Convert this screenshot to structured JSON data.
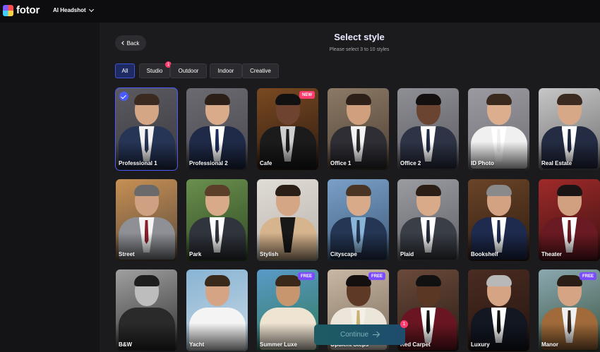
{
  "header": {
    "logo_text": "fotor",
    "product_menu_label": "AI Headshot"
  },
  "page": {
    "back_label": "Back",
    "title": "Select style",
    "subtitle": "Please select 3 to 10 styles",
    "continue_label": "Continue",
    "continue_badge": "1"
  },
  "tabs": [
    {
      "label": "All",
      "active": true,
      "badge": ""
    },
    {
      "label": "Studio",
      "active": false,
      "badge": "1"
    },
    {
      "label": "Outdoor",
      "active": false,
      "badge": ""
    },
    {
      "label": "Indoor",
      "active": false,
      "badge": ""
    },
    {
      "label": "Creative",
      "active": false,
      "badge": ""
    }
  ],
  "styles": [
    {
      "label": "Professional 1",
      "selected": true,
      "badge": ""
    },
    {
      "label": "Professional 2",
      "selected": false,
      "badge": ""
    },
    {
      "label": "Cafe",
      "selected": false,
      "badge": "NEW"
    },
    {
      "label": "Office 1",
      "selected": false,
      "badge": ""
    },
    {
      "label": "Office 2",
      "selected": false,
      "badge": ""
    },
    {
      "label": "ID Photo",
      "selected": false,
      "badge": ""
    },
    {
      "label": "Real Estate",
      "selected": false,
      "badge": ""
    },
    {
      "label": "Street",
      "selected": false,
      "badge": ""
    },
    {
      "label": "Park",
      "selected": false,
      "badge": ""
    },
    {
      "label": "Stylish",
      "selected": false,
      "badge": ""
    },
    {
      "label": "Cityscape",
      "selected": false,
      "badge": ""
    },
    {
      "label": "Plaid",
      "selected": false,
      "badge": ""
    },
    {
      "label": "Bookshelf",
      "selected": false,
      "badge": ""
    },
    {
      "label": "Theater",
      "selected": false,
      "badge": ""
    },
    {
      "label": "B&W",
      "selected": false,
      "badge": ""
    },
    {
      "label": "Yacht",
      "selected": false,
      "badge": ""
    },
    {
      "label": "Summer Luxe",
      "selected": false,
      "badge": "FREE"
    },
    {
      "label": "Opulent Steps",
      "selected": false,
      "badge": "FREE"
    },
    {
      "label": "Red Carpet",
      "selected": false,
      "badge": ""
    },
    {
      "label": "Luxury",
      "selected": false,
      "badge": ""
    },
    {
      "label": "Manor",
      "selected": false,
      "badge": "FREE"
    }
  ],
  "colors": {
    "accent": "#4a5cff",
    "new_badge": "#ff3d6e",
    "free_badge": "#7b4dff"
  }
}
